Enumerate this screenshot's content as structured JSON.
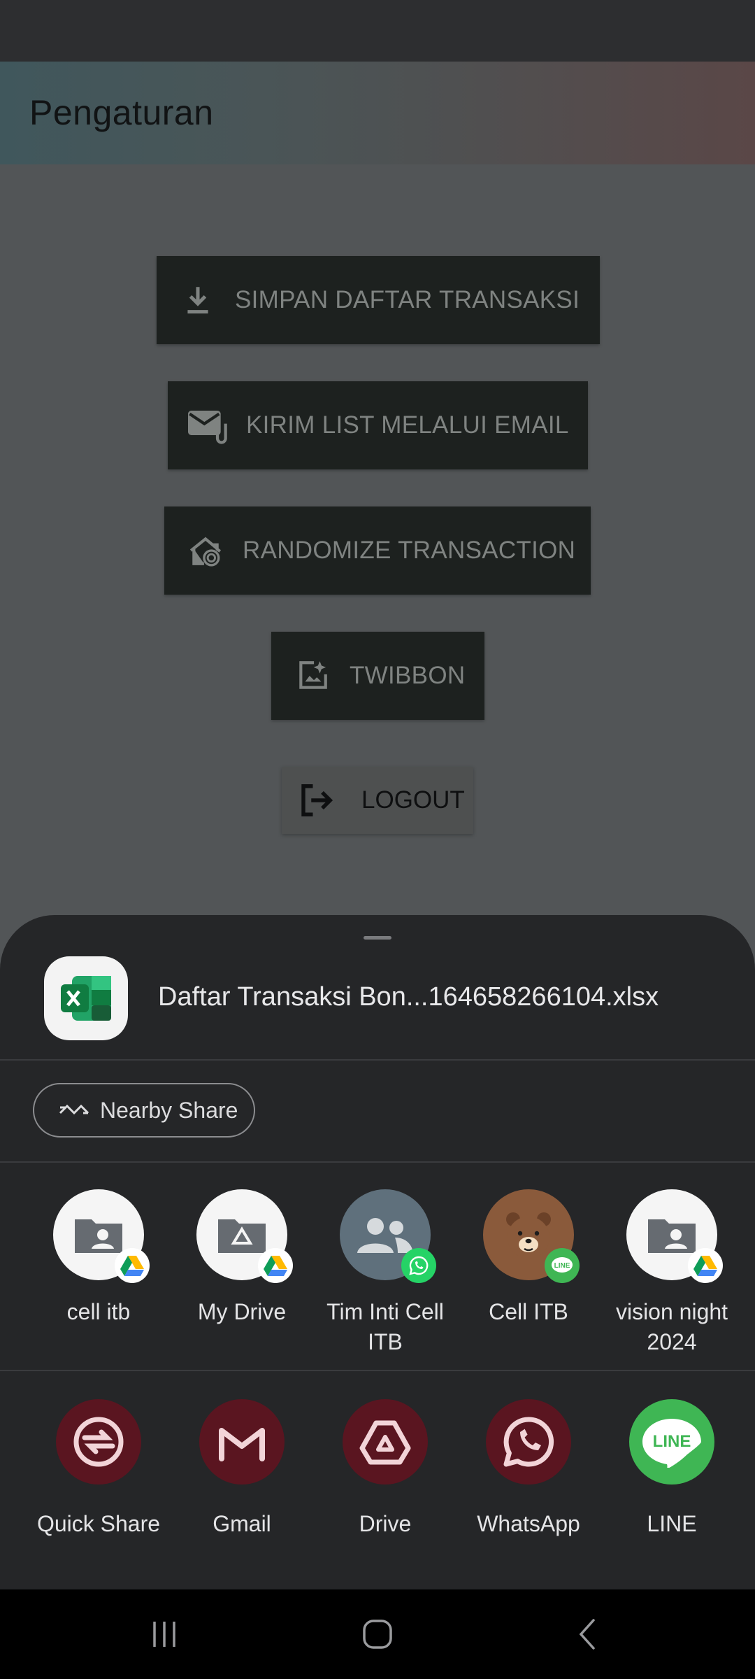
{
  "app": {
    "title": "Pengaturan"
  },
  "settings": {
    "buttons": [
      {
        "label": "SIMPAN DAFTAR TRANSAKSI",
        "icon": "download-icon"
      },
      {
        "label": "KIRIM LIST MELALUI EMAIL",
        "icon": "email-attachment-icon"
      },
      {
        "label": "RANDOMIZE TRANSACTION",
        "icon": "home-fingerprint-icon"
      },
      {
        "label": "TWIBBON",
        "icon": "sparkle-photo-icon"
      }
    ],
    "logout_label": "LOGOUT"
  },
  "share_sheet": {
    "file_name": "Daftar Transaksi Bon...164658266104.xlsx",
    "nearby_share_label": "Nearby Share",
    "contacts": [
      {
        "label": "cell itb",
        "icon": "shared-folder-icon",
        "badge": "google-drive-icon"
      },
      {
        "label": "My Drive",
        "icon": "drive-folder-icon",
        "badge": "google-drive-icon"
      },
      {
        "label": "Tim Inti Cell ITB",
        "icon": "group-icon",
        "badge": "whatsapp-icon"
      },
      {
        "label": "Cell ITB",
        "icon": "brown-bear-icon",
        "badge": "line-icon"
      },
      {
        "label": "vision night 2024",
        "icon": "shared-folder-icon",
        "badge": "google-drive-icon"
      }
    ],
    "apps": [
      {
        "label": "Quick Share",
        "icon": "quick-share-icon"
      },
      {
        "label": "Gmail",
        "icon": "gmail-icon"
      },
      {
        "label": "Drive",
        "icon": "drive-icon"
      },
      {
        "label": "WhatsApp",
        "icon": "whatsapp-icon"
      },
      {
        "label": "LINE",
        "icon": "line-icon"
      }
    ]
  },
  "colors": {
    "sheet_bg": "#252628",
    "button_bg": "#1d211f",
    "app_tile_bg": "#5a1520",
    "line_green": "#3fb654"
  }
}
